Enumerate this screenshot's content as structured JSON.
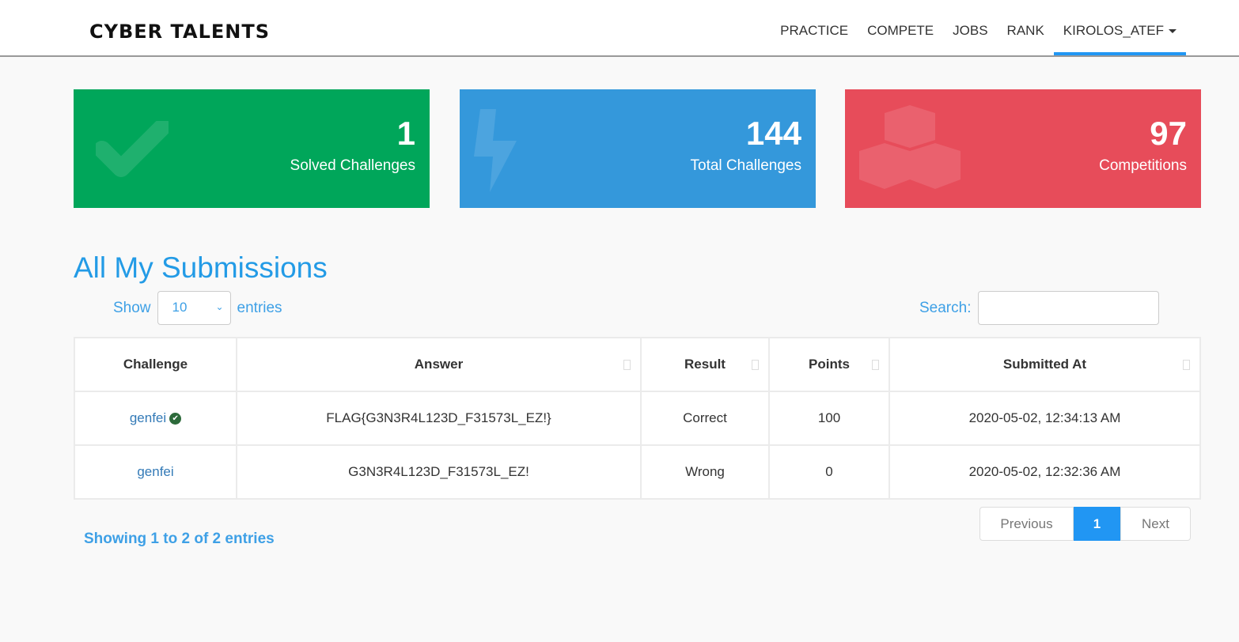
{
  "nav": {
    "logo": "CYBER TALENTS",
    "items": [
      "PRACTICE",
      "COMPETE",
      "JOBS",
      "RANK"
    ],
    "user": "KIROLOS_ATEF"
  },
  "cards": [
    {
      "value": "1",
      "label": "Solved Challenges",
      "color": "#00a65a",
      "icon": "check-icon"
    },
    {
      "value": "144",
      "label": "Total Challenges",
      "color": "#3498db",
      "icon": "bolt-icon"
    },
    {
      "value": "97",
      "label": "Competitions",
      "color": "#e74c5a",
      "icon": "cubes-icon"
    }
  ],
  "title": "All My Submissions",
  "length": {
    "show": "Show",
    "value": "10",
    "entries": "entries"
  },
  "search": {
    "label": "Search:",
    "value": ""
  },
  "table": {
    "headers": [
      "Challenge",
      "Answer",
      "Result",
      "Points",
      "Submitted At"
    ],
    "rows": [
      {
        "challenge": "genfei",
        "solved": true,
        "answer": "FLAG{G3N3R4L123D_F31573L_EZ!}",
        "result": "Correct",
        "points": "100",
        "submitted": "2020-05-02, 12:34:13 AM"
      },
      {
        "challenge": "genfei",
        "solved": false,
        "answer": "G3N3R4L123D_F31573L_EZ!",
        "result": "Wrong",
        "points": "0",
        "submitted": "2020-05-02, 12:32:36 AM"
      }
    ]
  },
  "info": "Showing 1 to 2 of 2 entries",
  "pagination": {
    "previous": "Previous",
    "current": "1",
    "next": "Next"
  }
}
